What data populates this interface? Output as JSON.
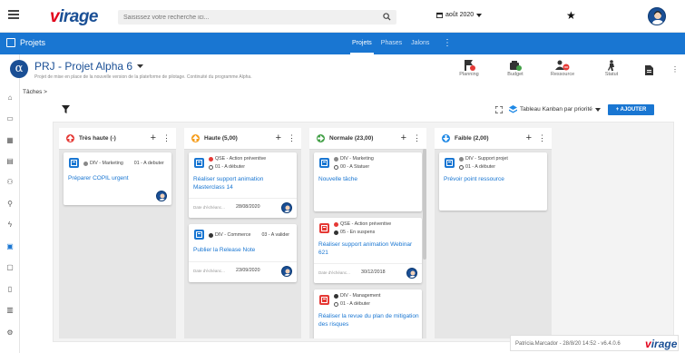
{
  "header": {
    "logo": "virage",
    "logo_v": "v",
    "logo_rest": "irage",
    "search_placeholder": "Saisissez votre recherche ici...",
    "date": "août 2020"
  },
  "nav": {
    "title": "Projets",
    "tabs": [
      "Projets",
      "Phases",
      "Jalons"
    ]
  },
  "project": {
    "logo_letter": "α",
    "title": "PRJ - Projet Alpha 6",
    "subtitle": "Projet de mise en place de la nouvelle version de la plateforme de pilotage. Continuité du programme Alpha.",
    "actions": [
      "Planning",
      "Budget",
      "Ressource",
      "Statut"
    ]
  },
  "breadcrumb": "Tâches >",
  "toolbar": {
    "view": "Tableau Kanban par priorité",
    "add_label": "+ AJOUTER"
  },
  "columns": [
    {
      "label": "Très haute (-)",
      "color": "#e53935",
      "cards": [
        {
          "meta1": "DIV - Marketing",
          "meta1b": "01 - A debuter",
          "title": "Préparer COPIL urgent",
          "date_label": "",
          "date": "",
          "tag_color": "#1976d2"
        }
      ]
    },
    {
      "label": "Haute (5,00)",
      "color": "#f59c1a",
      "cards": [
        {
          "meta1": "QSE - Action préventive",
          "meta2": "01 - A débuter",
          "title": "Réaliser support animation Masterclass 14",
          "date_label": "Date d'échéanc...",
          "date": "28/08/2020",
          "tag_color": "#1976d2"
        },
        {
          "meta1": "DIV - Commerce",
          "meta1b": "03 - A valider",
          "title": "Publier la Release Note",
          "date_label": "Date d'échéanc...",
          "date": "23/09/2020",
          "tag_color": "#1976d2"
        }
      ]
    },
    {
      "label": "Normale (23,00)",
      "color": "#43a047",
      "cards": [
        {
          "meta1": "DIV - Marketing",
          "meta2": "00 - A Statuer",
          "title": "Nouvelle tâche",
          "date_label": "",
          "date": "",
          "tag_color": "#1976d2"
        },
        {
          "meta1": "QSE - Action préventive",
          "meta2": "05 - En suspens",
          "title": "Réaliser support animation Webinar 621",
          "date_label": "Date d'échéanc...",
          "date": "30/12/2018",
          "tag_color": "#e53935"
        },
        {
          "meta1": "DIV - Management",
          "meta2": "01 - A débuter",
          "title": "Réaliser la revue du plan de mitigation des risques",
          "date_label": "",
          "date": "",
          "tag_color": "#e53935"
        }
      ]
    },
    {
      "label": "Faible (2,00)",
      "color": "#1e88e5",
      "cards": [
        {
          "meta1": "DIV - Support projet",
          "meta2": "01 - A débuter",
          "title": "Prévoir point ressource",
          "date_label": "",
          "date": "",
          "tag_color": "#1976d2"
        }
      ]
    }
  ],
  "footer": {
    "text": "Patricia.Marcador - 28/8/20 14:52 - v6.4.0.6",
    "logo_v": "v",
    "logo_rest": "irage"
  }
}
